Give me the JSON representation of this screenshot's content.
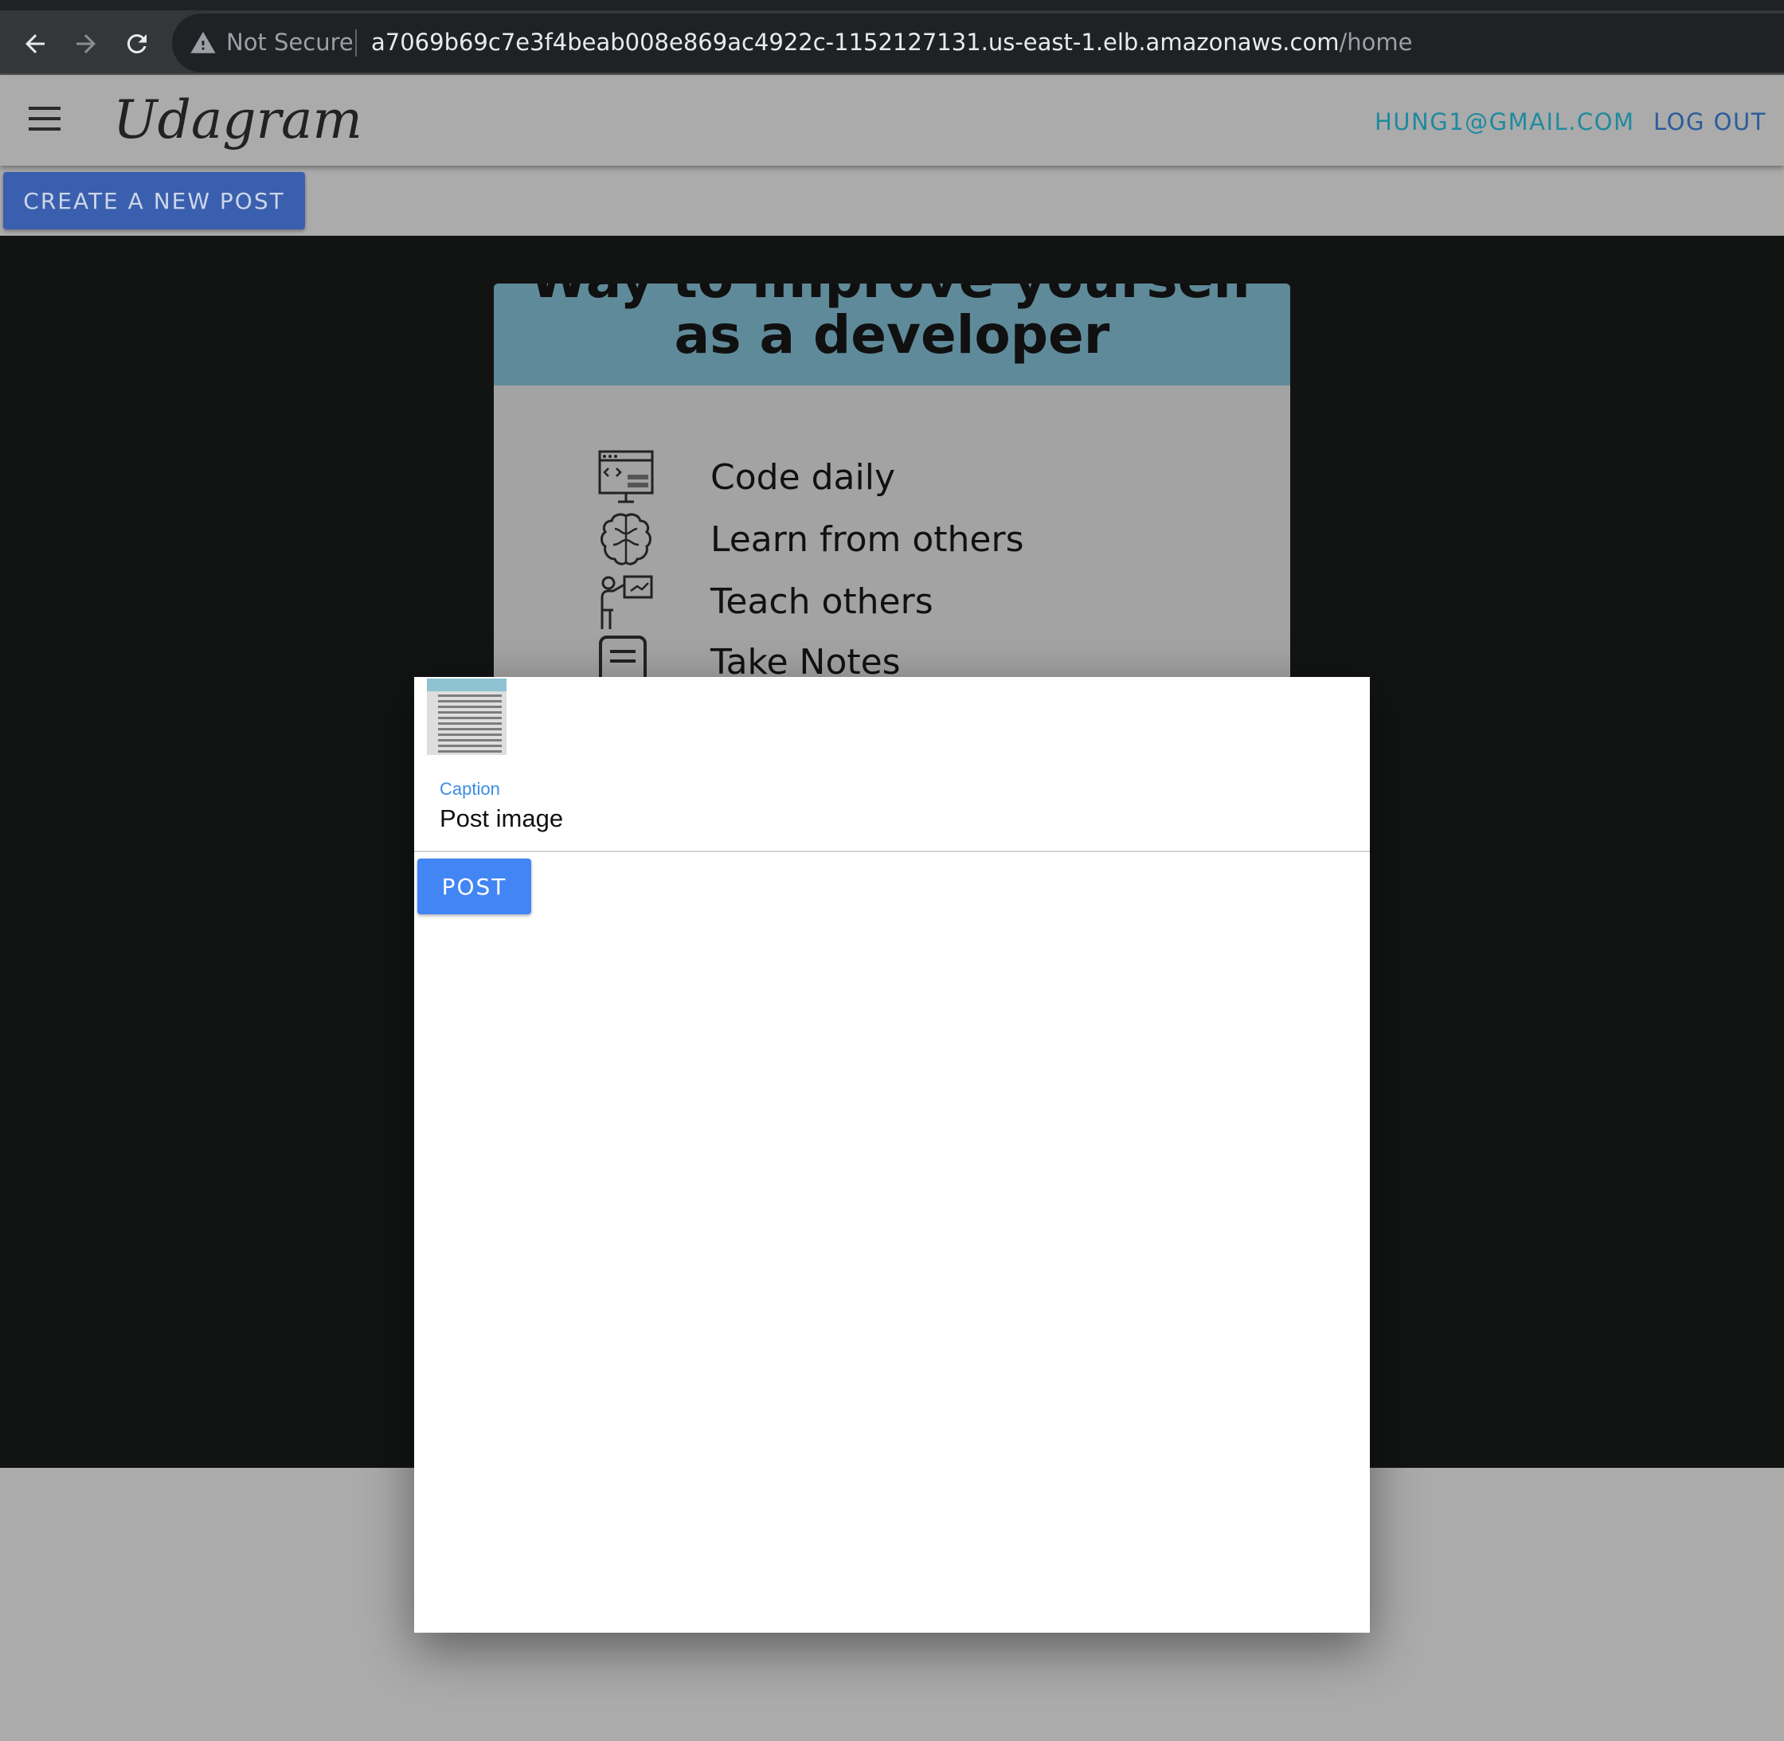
{
  "browser": {
    "security_label": "Not Secure",
    "url_host": "a7069b69c7e3f4beab008e869ac4922c-1152127131.us-east-1.elb.amazonaws.com",
    "url_path": "/home",
    "icons": [
      "back-arrow-icon",
      "forward-arrow-icon",
      "reload-icon",
      "warning-icon"
    ]
  },
  "header": {
    "brand": "Udagram",
    "user_email": "HUNG1@GMAIL.COM",
    "logout_label": "LOG OUT",
    "menu_icon": "hamburger-menu-icon"
  },
  "toolbar": {
    "create_label": "CREATE A NEW POST"
  },
  "background_post": {
    "title_cut": "Way to improve yourself",
    "title": "as a developer",
    "tips": [
      "Code daily",
      "Learn from others",
      "Teach others",
      "Take Notes"
    ]
  },
  "dialog": {
    "caption_label": "Caption",
    "caption_value": "Post image",
    "post_label": "POST"
  },
  "colors": {
    "primary_button": "#4285f4",
    "caption_label": "#3b8de0",
    "email_link": "#1f8aa0",
    "logout_link": "#2b5c9a"
  }
}
